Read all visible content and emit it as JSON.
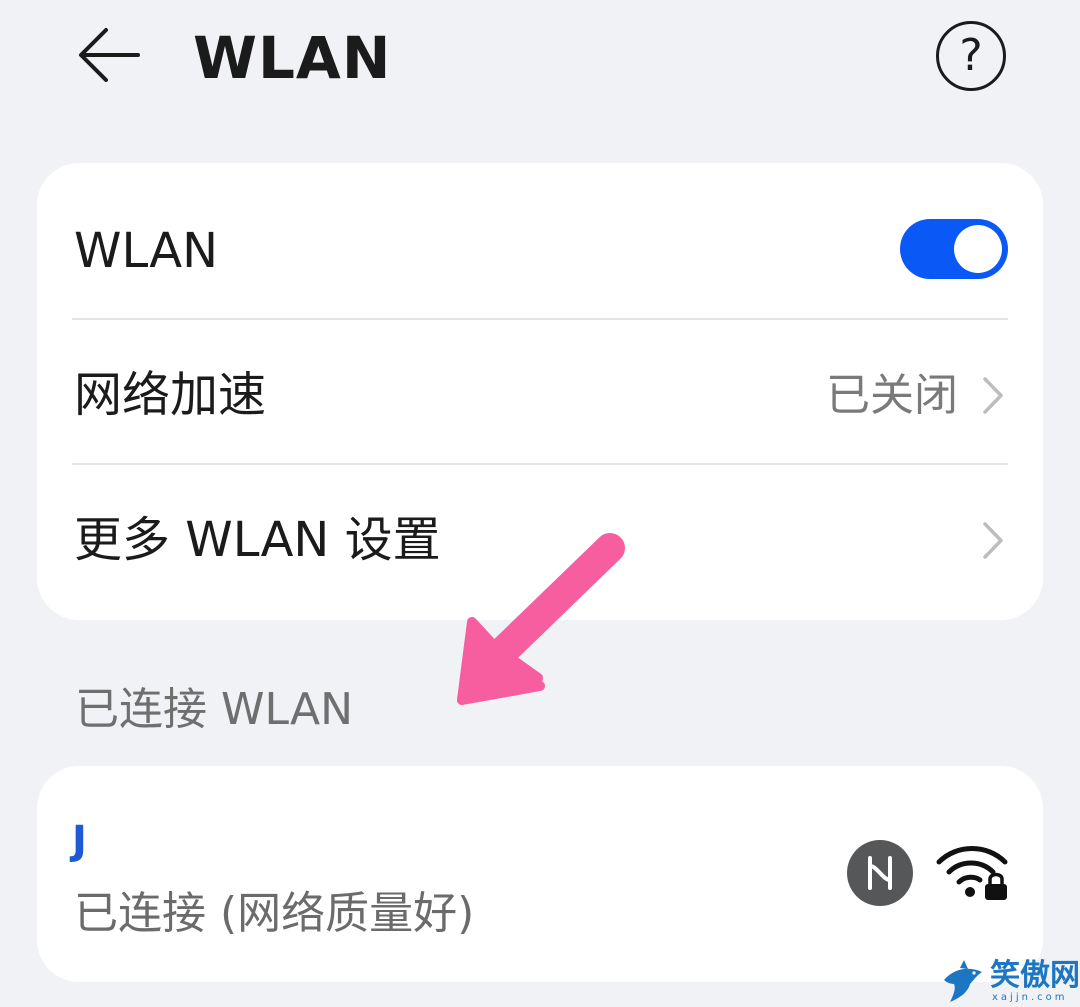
{
  "header": {
    "title": "WLAN",
    "back_icon": "arrow-left-icon",
    "help_icon": "question-circle-icon",
    "help_glyph": "?"
  },
  "settings": {
    "wlan_label": "WLAN",
    "wlan_enabled": true,
    "accel_label": "网络加速",
    "accel_value": "已关闭",
    "more_label": "更多 WLAN 设置"
  },
  "connected": {
    "section_label": "已连接 WLAN",
    "network_name": "J",
    "network_status": "已连接 (网络质量好)",
    "badge_icon": "harmony-h-icon",
    "signal_icon": "wifi-locked-icon"
  },
  "watermark": {
    "text": "笑傲网",
    "url": "xajjn.com"
  },
  "colors": {
    "background": "#f1f2f5",
    "card": "#ffffff",
    "accent": "#0a59f7",
    "annotation": "#f65ea0",
    "secondary_text": "#7a7a7a"
  }
}
